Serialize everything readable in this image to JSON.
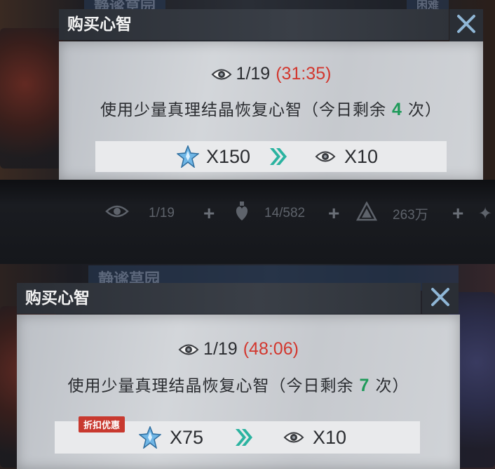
{
  "background": {
    "top_banner": "静谧草园",
    "top_badge": "困难",
    "bottom_banner": "静谧草园"
  },
  "resource_bar": {
    "items": [
      {
        "icon": "eye-icon",
        "value": "1/19"
      },
      {
        "icon": "heart-vial-icon",
        "value": "14/582"
      },
      {
        "icon": "triangle-gem-icon",
        "value": "263万"
      }
    ]
  },
  "dialog_top": {
    "title": "购买心智",
    "mind_count": "1/19",
    "timer": "(31:35)",
    "desc_before": "使用少量真理结晶恢复心智（今日剩余",
    "remaining": "4",
    "desc_after": "次）",
    "cost": "X150",
    "gain": "X10"
  },
  "dialog_bottom": {
    "title": "购买心智",
    "mind_count": "1/19",
    "timer": "(48:06)",
    "desc_before": "使用少量真理结晶恢复心智（今日剩余",
    "remaining": "7",
    "desc_after": "次）",
    "discount_tag": "折扣优惠",
    "cost": "X75",
    "gain": "X10"
  },
  "colors": {
    "timer": "#d2372e",
    "remaining": "#1f9a5a",
    "arrow": "#2bb3a0",
    "tag": "#c8392f"
  }
}
